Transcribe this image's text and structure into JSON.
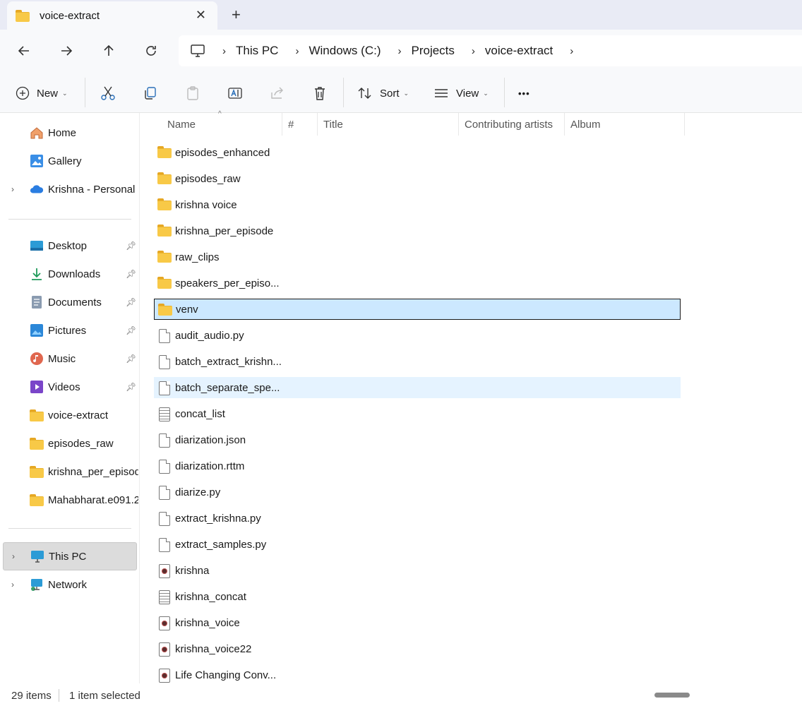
{
  "tab": {
    "title": "voice-extract",
    "close": "✕",
    "new": "+"
  },
  "nav": {
    "back": "←",
    "forward": "→",
    "up": "↑",
    "refresh": "↻"
  },
  "breadcrumb": [
    "This PC",
    "Windows (C:)",
    "Projects",
    "voice-extract"
  ],
  "toolbar": {
    "new_label": "New",
    "sort_label": "Sort",
    "view_label": "View",
    "more": "•••"
  },
  "columns": {
    "name": "Name",
    "number": "#",
    "title": "Title",
    "artists": "Contributing artists",
    "album": "Album"
  },
  "sidebar": {
    "home": "Home",
    "gallery": "Gallery",
    "onedrive": "Krishna - Personal",
    "desktop": "Desktop",
    "downloads": "Downloads",
    "documents": "Documents",
    "pictures": "Pictures",
    "music": "Music",
    "videos": "Videos",
    "pin1": "voice-extract",
    "pin2": "episodes_raw",
    "pin3": "krishna_per_episode",
    "pin4": "Mahabharat.e091.2",
    "thispc": "This PC",
    "network": "Network"
  },
  "files": [
    {
      "name": "episodes_enhanced",
      "type": "folder"
    },
    {
      "name": "episodes_raw",
      "type": "folder"
    },
    {
      "name": "krishna voice",
      "type": "folder"
    },
    {
      "name": "krishna_per_episode",
      "type": "folder"
    },
    {
      "name": "raw_clips",
      "type": "folder"
    },
    {
      "name": "speakers_per_episo...",
      "type": "folder"
    },
    {
      "name": "venv",
      "type": "folder"
    },
    {
      "name": "audit_audio.py",
      "type": "file"
    },
    {
      "name": "batch_extract_krishn...",
      "type": "file"
    },
    {
      "name": "batch_separate_spe...",
      "type": "file"
    },
    {
      "name": "concat_list",
      "type": "text"
    },
    {
      "name": "diarization.json",
      "type": "file"
    },
    {
      "name": "diarization.rttm",
      "type": "file"
    },
    {
      "name": "diarize.py",
      "type": "file"
    },
    {
      "name": "extract_krishna.py",
      "type": "file"
    },
    {
      "name": "extract_samples.py",
      "type": "file"
    },
    {
      "name": "krishna",
      "type": "media"
    },
    {
      "name": "krishna_concat",
      "type": "text"
    },
    {
      "name": "krishna_voice",
      "type": "media"
    },
    {
      "name": "krishna_voice22",
      "type": "media"
    },
    {
      "name": "Life Changing Conv...",
      "type": "media"
    }
  ],
  "status": {
    "count": "29 items",
    "selected": "1 item selected"
  },
  "colors": {
    "selection": "#cce8ff",
    "hover": "#e5f3ff",
    "folder": "#f8c947",
    "accent": "#0067c0"
  }
}
